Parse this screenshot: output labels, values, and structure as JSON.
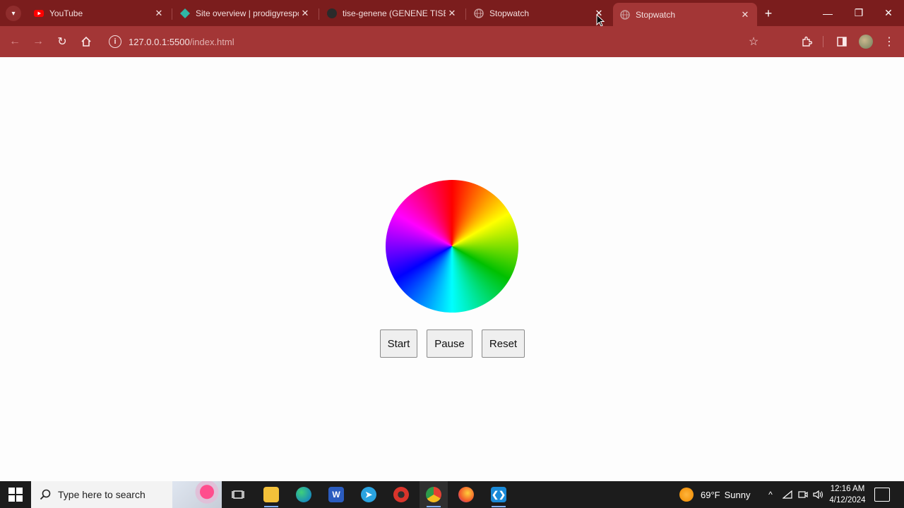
{
  "browser": {
    "tabs": [
      {
        "title": "YouTube",
        "icon": "youtube-icon",
        "icon_color": "#ff0000",
        "active": false
      },
      {
        "title": "Site overview | prodigyresponsive",
        "icon": "netlify-icon",
        "icon_color": "#30b7a5",
        "active": false
      },
      {
        "title": "tise-genene (GENENE TISE)",
        "icon": "github-icon",
        "icon_color": "#222222",
        "active": false
      },
      {
        "title": "Stopwatch",
        "icon": "globe-icon",
        "icon_color": "#9a8d8d",
        "active": false
      },
      {
        "title": "Stopwatch",
        "icon": "globe-icon",
        "icon_color": "#9a8d8d",
        "active": true
      }
    ],
    "address": {
      "host": "127.0.0.1:5500",
      "path": "/index.html"
    },
    "theme_color": "#a33636"
  },
  "page": {
    "buttons": {
      "start": "Start",
      "pause": "Pause",
      "reset": "Reset"
    }
  },
  "taskbar": {
    "search_placeholder": "Type here to search",
    "weather": {
      "temp": "69°F",
      "condition": "Sunny"
    },
    "clock": {
      "time": "12:16 AM",
      "date": "4/12/2024"
    }
  }
}
